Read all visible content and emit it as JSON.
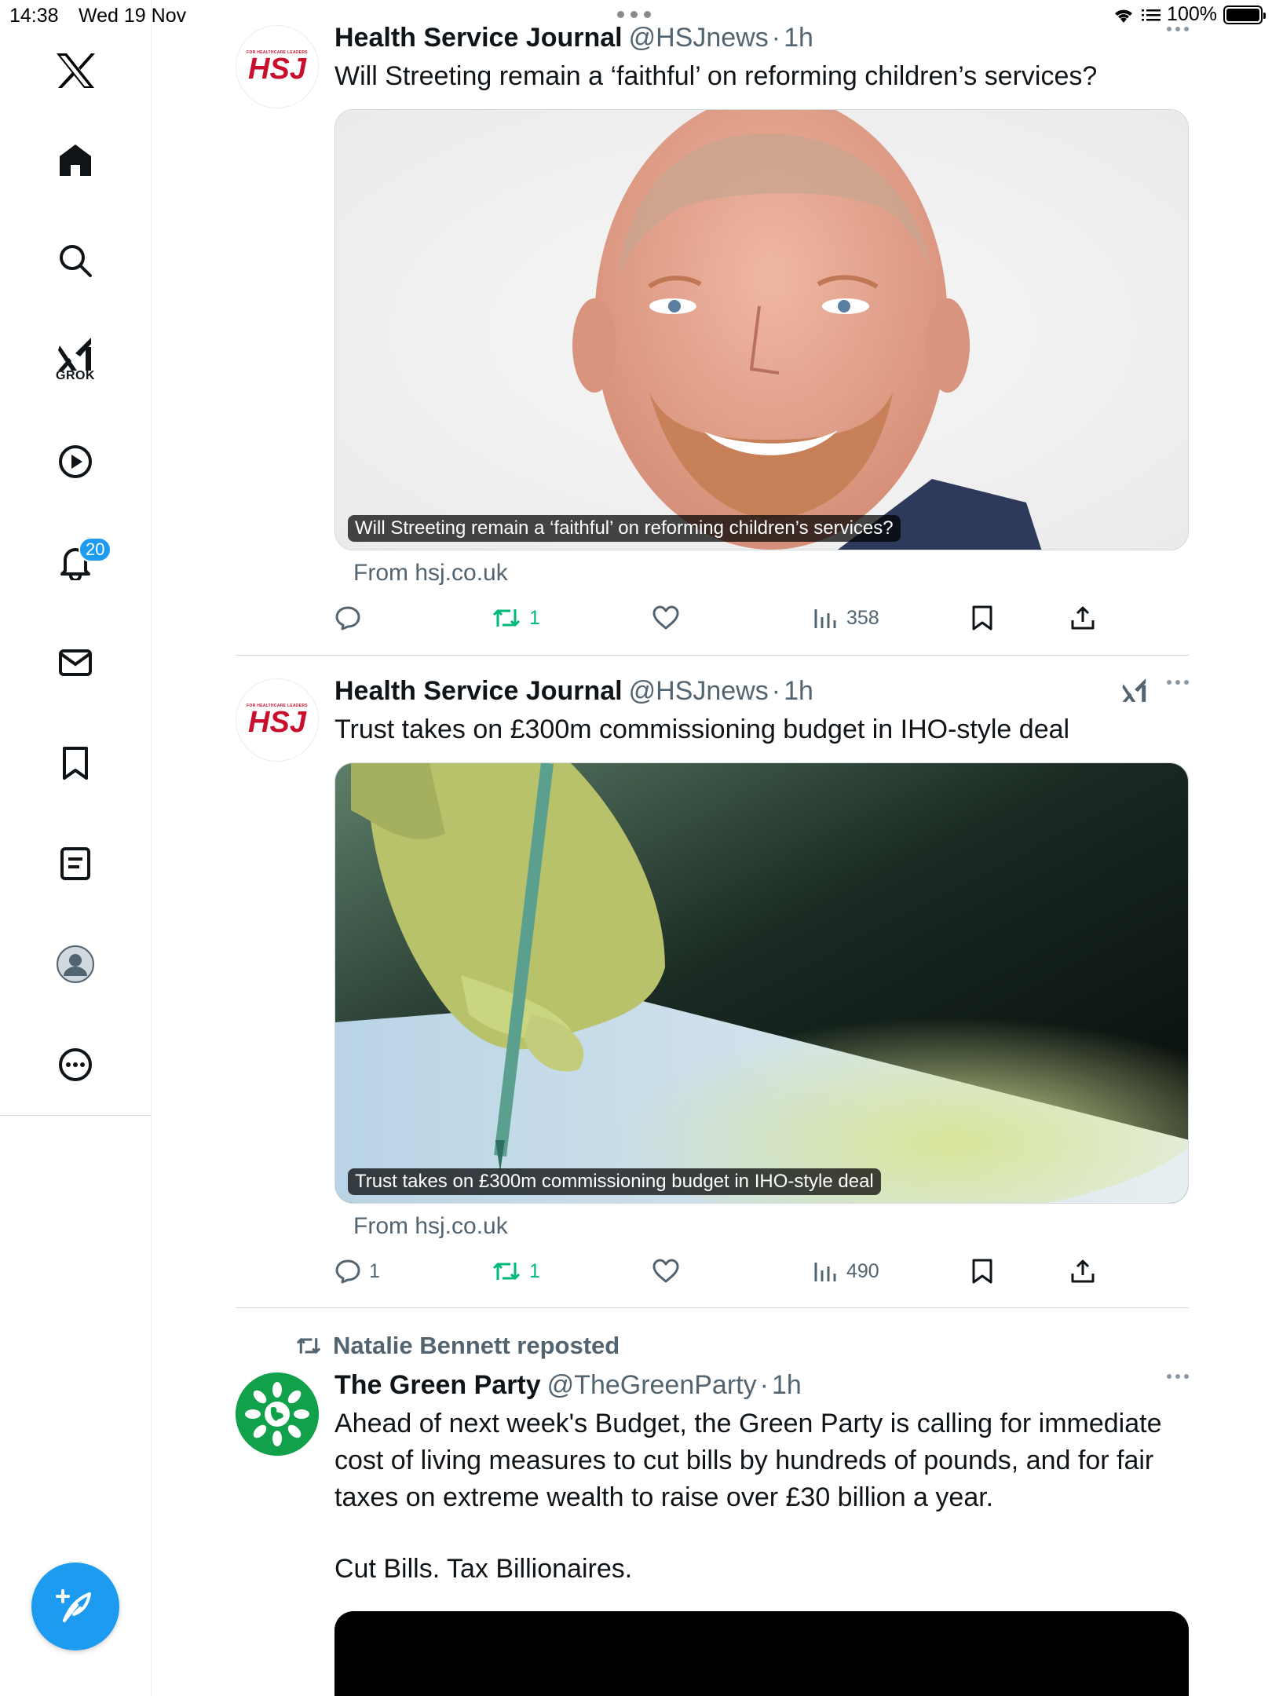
{
  "status_bar": {
    "time": "14:38",
    "date": "Wed 19 Nov",
    "battery": "100%"
  },
  "sidebar": {
    "items": [
      {
        "name": "x-logo"
      },
      {
        "name": "home"
      },
      {
        "name": "search"
      },
      {
        "name": "grok",
        "label": "GROK"
      },
      {
        "name": "videos"
      },
      {
        "name": "notifications",
        "badge": "20"
      },
      {
        "name": "messages"
      },
      {
        "name": "bookmarks"
      },
      {
        "name": "lists"
      },
      {
        "name": "profile"
      },
      {
        "name": "more"
      }
    ]
  },
  "tweets": [
    {
      "name": "Health Service Journal",
      "handle": "@HSJnews",
      "time": "1h",
      "text": "Will Streeting remain a ‘faithful’ on reforming children’s services?",
      "media_caption": "Will Streeting remain a ‘faithful’ on reforming children’s services?",
      "source": "From hsj.co.uk",
      "replies": "",
      "reposts": "1",
      "views": "358",
      "avatar_small": "FOR HEALTHCARE LEADERS",
      "avatar_big": "HSJ"
    },
    {
      "name": "Health Service Journal",
      "handle": "@HSJnews",
      "time": "1h",
      "text": "Trust takes on £300m commissioning budget in IHO-style deal",
      "media_caption": "Trust takes on £300m commissioning budget in IHO-style deal",
      "source": "From hsj.co.uk",
      "replies": "1",
      "reposts": "1",
      "views": "490",
      "avatar_small": "FOR HEALTHCARE LEADERS",
      "avatar_big": "HSJ"
    },
    {
      "reposted_by": "Natalie Bennett reposted",
      "name": "The Green Party",
      "handle": "@TheGreenParty",
      "time": "1h",
      "text": "Ahead of next week's Budget, the Green Party is calling for immediate cost of living measures to cut bills by hundreds of pounds, and for fair taxes on extreme wealth to raise over £30 billion a year.",
      "text2": "Cut Bills. Tax Billionaires."
    }
  ],
  "colors": {
    "accent": "#1d9bf0",
    "repost_green": "#00ba7c",
    "muted": "#536471",
    "hsj_red": "#c8102e",
    "green_party": "#10a14a"
  }
}
